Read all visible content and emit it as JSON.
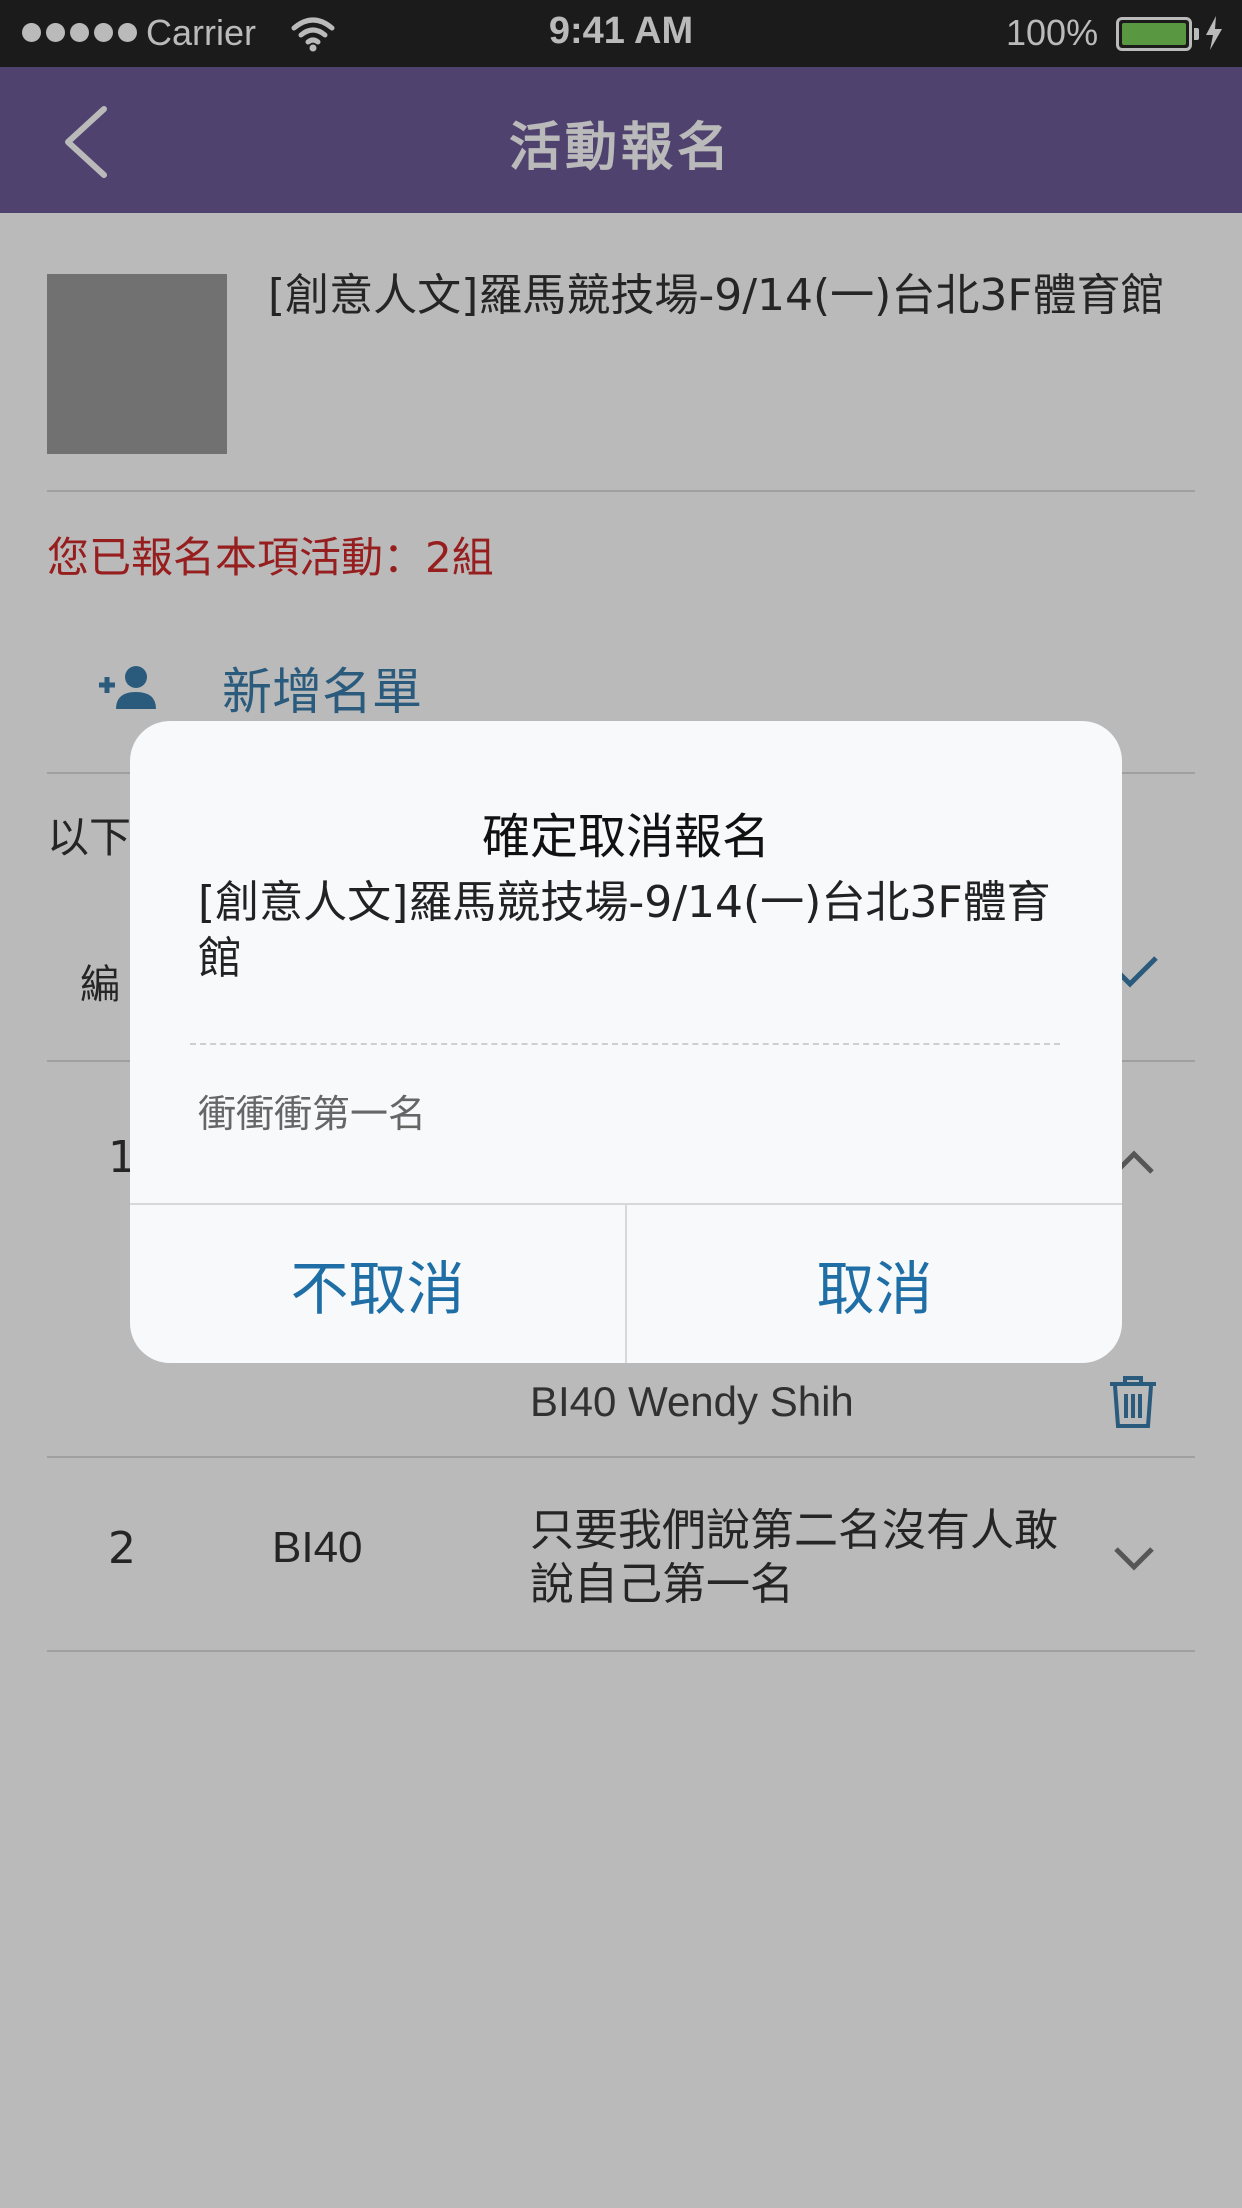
{
  "status_bar": {
    "carrier": "Carrier",
    "time": "9:41 AM",
    "battery": "100%",
    "battery_level": 1.0
  },
  "nav": {
    "title": "活動報名",
    "back_icon": "chevron-left-icon"
  },
  "event": {
    "title": "[創意人文]羅馬競技場-9/14(一)台北3F體育館"
  },
  "registration_info": "您已報名本項活動：2組",
  "add_list": {
    "icon": "add-person-icon",
    "label": "新增名單"
  },
  "list_intro_partial": "以下",
  "table": {
    "header_partial": "編",
    "rows": [
      {
        "num_partial": "1",
        "member": "BI40 Wendy Shih"
      },
      {
        "num": "2",
        "code": "BI40",
        "name": "只要我們說第二名沒有人敢說自己第一名"
      }
    ]
  },
  "dialog": {
    "title": "確定取消報名",
    "event": "[創意人文]羅馬競技場-9/14(一)台北3F體育館",
    "team": "衝衝衝第一名",
    "cancel_label": "不取消",
    "confirm_label": "取消"
  },
  "colors": {
    "nav": "#6d5b99",
    "accent": "#3c7dab",
    "alert": "#cf2a2a",
    "dialog_button": "#1f6fa6"
  }
}
